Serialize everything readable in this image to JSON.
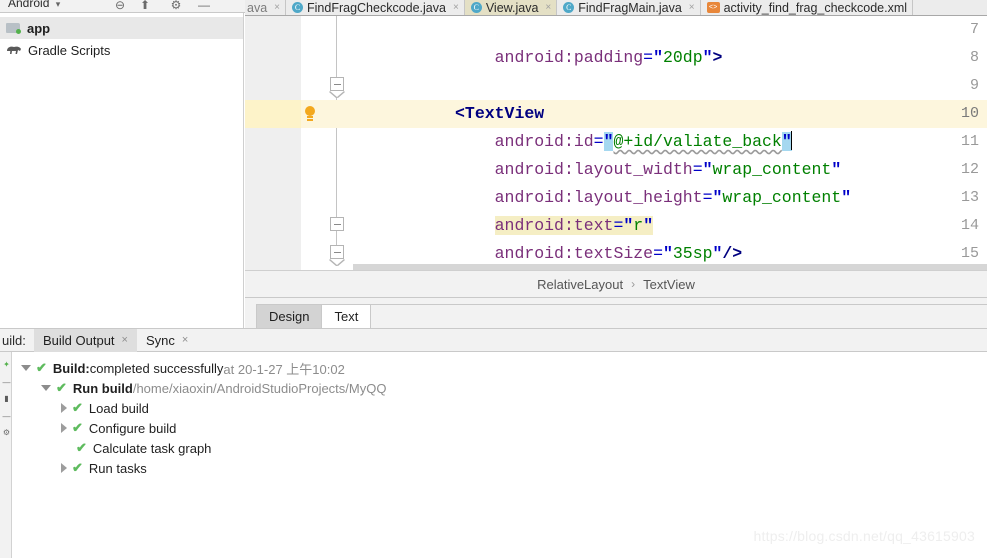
{
  "project_panel": {
    "dropdown_label": "Android",
    "dropdown_caret": "▾",
    "toolbar_icons": [
      {
        "name": "collapse-all-icon",
        "glyph": "⊖"
      },
      {
        "name": "expand-all-icon",
        "glyph": "⬆"
      },
      {
        "name": "settings-gear-icon",
        "glyph": "⚙"
      },
      {
        "name": "hide-panel-icon",
        "glyph": "—"
      }
    ],
    "tree": [
      {
        "label": "app",
        "icon": "folder-module-icon",
        "selected": true
      },
      {
        "label": "Gradle Scripts",
        "icon": "gradle-elephant-icon",
        "selected": false
      }
    ]
  },
  "editor_tabs": [
    {
      "label": "ava",
      "icon": "java-file-icon",
      "state": "partial",
      "close": "×"
    },
    {
      "label": "FindFragCheckcode.java",
      "icon": "java-file-icon",
      "state": "plain",
      "close": "×"
    },
    {
      "label": "View.java",
      "icon": "java-file-icon",
      "state": "beige",
      "close": "×"
    },
    {
      "label": "FindFragMain.java",
      "icon": "java-file-icon",
      "state": "plain",
      "close": "×"
    },
    {
      "label": "activity_find_frag_checkcode.xml",
      "icon": "xml-file-icon",
      "state": "plain",
      "close": "×"
    }
  ],
  "editor": {
    "line_numbers": [
      "7",
      "8",
      "9",
      "10",
      "11",
      "12",
      "13",
      "14",
      "15"
    ],
    "highlighted_line": "10",
    "lightbulb_line": "10",
    "fold_lines": [
      "9",
      "14",
      "15"
    ],
    "lines": [
      {
        "n": "7",
        "text": "        android:padding=\"20dp\">"
      },
      {
        "n": "8",
        "text": ""
      },
      {
        "n": "9",
        "text": "    <TextView"
      },
      {
        "n": "10",
        "text": "        android:id=\"@+id/valiate_back\""
      },
      {
        "n": "11",
        "text": "        android:layout_width=\"wrap_content\""
      },
      {
        "n": "12",
        "text": "        android:layout_height=\"wrap_content\""
      },
      {
        "n": "13",
        "text": "        android:text=\"r\""
      },
      {
        "n": "14",
        "text": "        android:textSize=\"35sp\"/>"
      },
      {
        "n": "15",
        "text": "    <TextView"
      }
    ]
  },
  "breadcrumb": {
    "root": "RelativeLayout",
    "separator": "›",
    "leaf": "TextView"
  },
  "design_text_tabs": [
    {
      "label": "Design",
      "active": false
    },
    {
      "label": "Text",
      "active": true
    }
  ],
  "build_panel": {
    "tool_label": "uild:",
    "tabs": [
      {
        "label": "Build Output",
        "active": true,
        "close": "×"
      },
      {
        "label": "Sync",
        "active": false,
        "close": "×"
      }
    ],
    "sidebar_icons": [
      {
        "name": "restart-build-icon",
        "glyph": "✦"
      },
      {
        "name": "collapse-rows-icon",
        "glyph": "—"
      },
      {
        "name": "toggle-soft-wrap-icon",
        "glyph": "▮"
      },
      {
        "name": "minus-row-icon",
        "glyph": "—"
      },
      {
        "name": "settings-icon",
        "glyph": "⚙"
      }
    ],
    "tree": [
      {
        "indent": 0,
        "toggle": "down",
        "status": "✔",
        "bold_text": "Build:",
        "text": " completed successfully",
        "dim_text": " at 20-1-27 上午10:02"
      },
      {
        "indent": 1,
        "toggle": "down",
        "status": "✔",
        "bold_text": "",
        "text": "Run build",
        "dim_text": " /home/xiaoxin/AndroidStudioProjects/MyQQ"
      },
      {
        "indent": 2,
        "toggle": "right",
        "status": "✔",
        "bold_text": "",
        "text": "Load build",
        "dim_text": ""
      },
      {
        "indent": 2,
        "toggle": "right",
        "status": "✔",
        "bold_text": "",
        "text": "Configure build",
        "dim_text": ""
      },
      {
        "indent": 2,
        "toggle": "none",
        "status": "✔",
        "bold_text": "",
        "text": "Calculate task graph",
        "dim_text": ""
      },
      {
        "indent": 2,
        "toggle": "right",
        "status": "✔",
        "bold_text": "",
        "text": "Run tasks",
        "dim_text": ""
      }
    ]
  },
  "watermark": {
    "text": "https://blog.csdn.net/qq_43615903"
  },
  "colors": {
    "tag": "#000080",
    "attribute": "#7a2f7a",
    "string": "#008000",
    "quote": "#0000c8",
    "selection": "#a5d8f0",
    "line_highlight": "#fdf6dd",
    "text_attr_highlight": "#f5eec4",
    "success_green": "#5ebb5e",
    "lightbulb": "#f3a81e"
  }
}
